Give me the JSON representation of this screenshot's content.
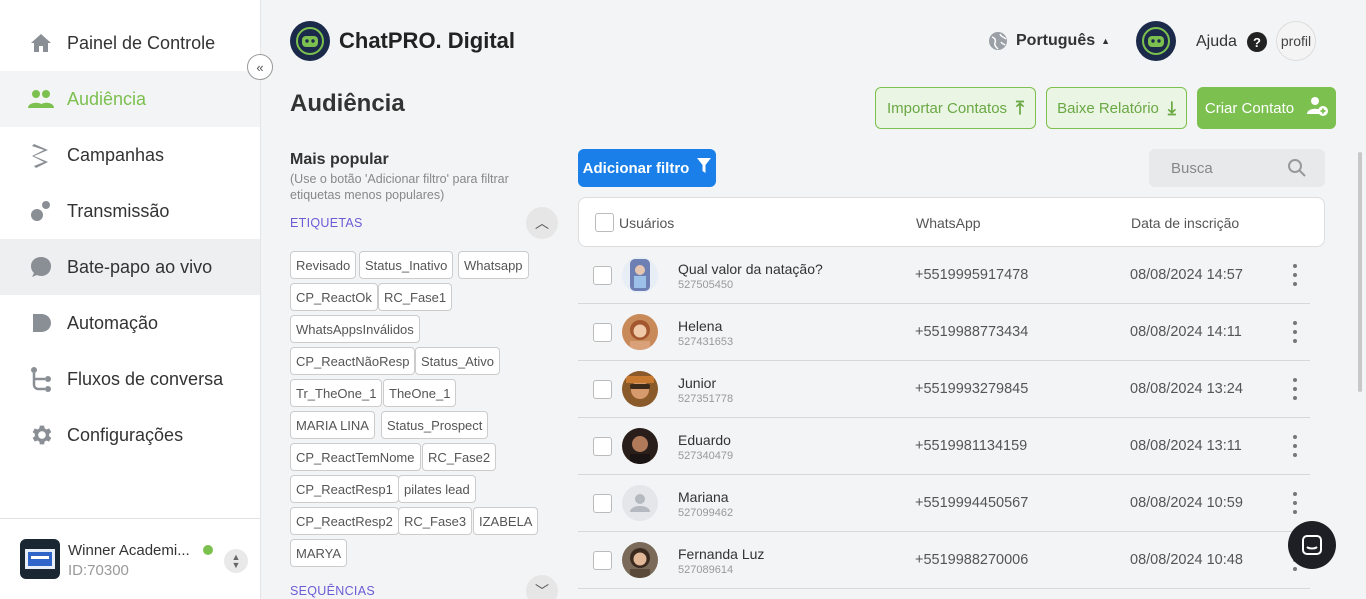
{
  "sidebar": {
    "items": [
      {
        "label": "Painel de Controle",
        "icon": "home-icon"
      },
      {
        "label": "Audiência",
        "icon": "users-icon",
        "active": true
      },
      {
        "label": "Campanhas",
        "icon": "campaign-icon"
      },
      {
        "label": "Transmissão",
        "icon": "broadcast-icon"
      },
      {
        "label": "Bate-papo ao vivo",
        "icon": "chat-bubble-icon"
      },
      {
        "label": "Automação",
        "icon": "automation-icon"
      },
      {
        "label": "Fluxos de conversa",
        "icon": "flow-icon"
      },
      {
        "label": "Configurações",
        "icon": "gear-icon"
      }
    ],
    "account": {
      "name": "Winner Academi...",
      "id": "ID:70300",
      "status_color": "#7cc04f"
    }
  },
  "header": {
    "brand": "ChatPRO. Digital",
    "language": "Português",
    "help": "Ajuda",
    "profile_alt": "profil"
  },
  "page": {
    "title": "Audiência",
    "import_label": "Importar Contatos",
    "report_label": "Baixe Relatório",
    "create_label": "Criar Contato"
  },
  "filters": {
    "title": "Mais popular",
    "hint": "(Use o botão 'Adicionar filtro' para filtrar etiquetas menos populares)",
    "tags_section": "ETIQUETAS",
    "sequences_section": "SEQUÊNCIAS",
    "tags": [
      "Revisado",
      "Status_Inativo",
      "Whatsapp",
      "CP_ReactOk",
      "RC_Fase1",
      "WhatsAppsInválidos",
      "CP_ReactNãoResp",
      "Status_Ativo",
      "Tr_TheOne_1",
      "TheOne_1",
      "MARIA LINA",
      "Status_Prospect",
      "CP_ReactTemNome",
      "RC_Fase2",
      "CP_ReactResp1",
      "pilates lead",
      "CP_ReactResp2",
      "RC_Fase3",
      "IZABELA",
      "MARYA"
    ]
  },
  "table": {
    "add_filter_label": "Adicionar filtro",
    "search_placeholder": "Busca",
    "columns": [
      "Usuários",
      "WhatsApp",
      "Data de inscrição"
    ],
    "rows": [
      {
        "name": "Qual valor da natação?",
        "id": "527505450",
        "phone": "+5519995917478",
        "date": "08/08/2024 14:57"
      },
      {
        "name": "Helena",
        "id": "527431653",
        "phone": "+5519988773434",
        "date": "08/08/2024 14:11"
      },
      {
        "name": "Junior",
        "id": "527351778",
        "phone": "+5519993279845",
        "date": "08/08/2024 13:24"
      },
      {
        "name": "Eduardo",
        "id": "527340479",
        "phone": "+5519981134159",
        "date": "08/08/2024 13:11"
      },
      {
        "name": "Mariana",
        "id": "527099462",
        "phone": "+5519994450567",
        "date": "08/08/2024 10:59"
      },
      {
        "name": "Fernanda Luz",
        "id": "527089614",
        "phone": "+5519988270006",
        "date": "08/08/2024 10:48"
      }
    ]
  },
  "colors": {
    "accent": "#7cc04f",
    "primary_blue": "#1a7fe8",
    "section_purple": "#6b5bd6"
  }
}
